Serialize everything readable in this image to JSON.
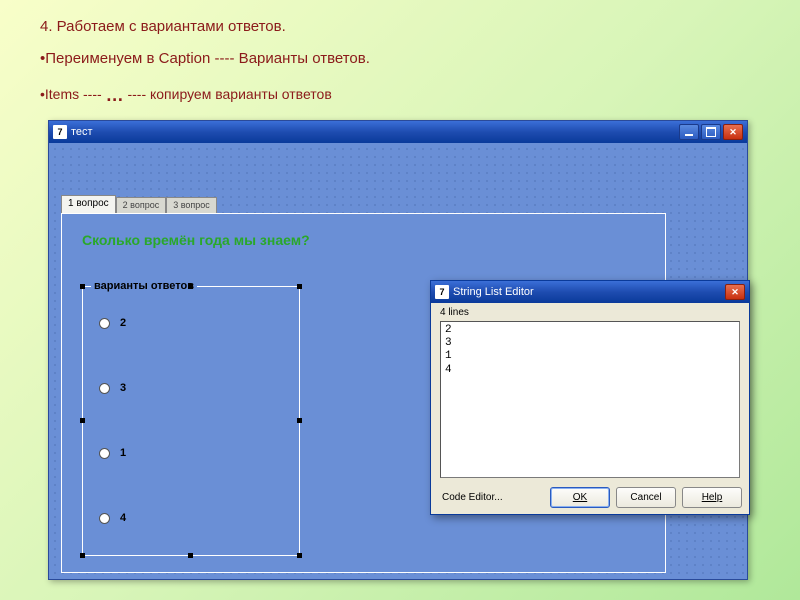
{
  "instructions": {
    "line1": "4. Работаем с вариантами ответов.",
    "line2": "•Переименуем в Caption ---- Варианты ответов.",
    "line3_a": "•Items ---- ",
    "line3_dots": "…",
    "line3_b": " ---- копируем варианты ответов"
  },
  "mainWindow": {
    "title": "тест",
    "tabs": [
      "1 вопрос",
      "2 вопрос",
      "3 вопрос"
    ],
    "activeTab": 0,
    "question": "Сколько времён года мы знаем?",
    "radiogroup": {
      "caption": "варианты ответов",
      "items": [
        "2",
        "3",
        "1",
        "4"
      ]
    }
  },
  "stringListEditor": {
    "title": "String List Editor",
    "countLabel": "4 lines",
    "lines": [
      "2",
      "3",
      "1",
      "4"
    ],
    "buttons": {
      "codeEditor": "Code Editor...",
      "ok": "OK",
      "cancel": "Cancel",
      "help": "Help"
    }
  }
}
